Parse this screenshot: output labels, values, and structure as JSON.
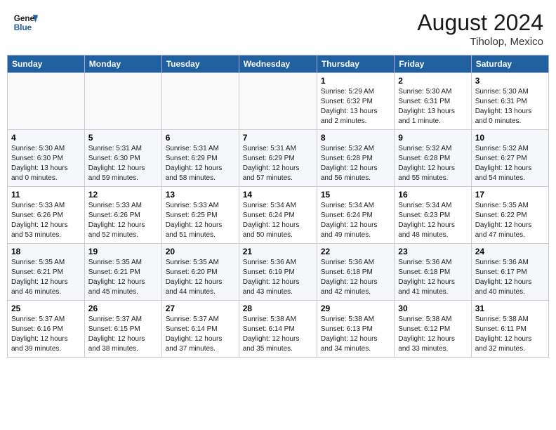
{
  "header": {
    "logo_line1": "General",
    "logo_line2": "Blue",
    "month_year": "August 2024",
    "location": "Tiholop, Mexico"
  },
  "days_of_week": [
    "Sunday",
    "Monday",
    "Tuesday",
    "Wednesday",
    "Thursday",
    "Friday",
    "Saturday"
  ],
  "weeks": [
    [
      {
        "day": "",
        "info": ""
      },
      {
        "day": "",
        "info": ""
      },
      {
        "day": "",
        "info": ""
      },
      {
        "day": "",
        "info": ""
      },
      {
        "day": "1",
        "info": "Sunrise: 5:29 AM\nSunset: 6:32 PM\nDaylight: 13 hours\nand 2 minutes."
      },
      {
        "day": "2",
        "info": "Sunrise: 5:30 AM\nSunset: 6:31 PM\nDaylight: 13 hours\nand 1 minute."
      },
      {
        "day": "3",
        "info": "Sunrise: 5:30 AM\nSunset: 6:31 PM\nDaylight: 13 hours\nand 0 minutes."
      }
    ],
    [
      {
        "day": "4",
        "info": "Sunrise: 5:30 AM\nSunset: 6:30 PM\nDaylight: 13 hours\nand 0 minutes."
      },
      {
        "day": "5",
        "info": "Sunrise: 5:31 AM\nSunset: 6:30 PM\nDaylight: 12 hours\nand 59 minutes."
      },
      {
        "day": "6",
        "info": "Sunrise: 5:31 AM\nSunset: 6:29 PM\nDaylight: 12 hours\nand 58 minutes."
      },
      {
        "day": "7",
        "info": "Sunrise: 5:31 AM\nSunset: 6:29 PM\nDaylight: 12 hours\nand 57 minutes."
      },
      {
        "day": "8",
        "info": "Sunrise: 5:32 AM\nSunset: 6:28 PM\nDaylight: 12 hours\nand 56 minutes."
      },
      {
        "day": "9",
        "info": "Sunrise: 5:32 AM\nSunset: 6:28 PM\nDaylight: 12 hours\nand 55 minutes."
      },
      {
        "day": "10",
        "info": "Sunrise: 5:32 AM\nSunset: 6:27 PM\nDaylight: 12 hours\nand 54 minutes."
      }
    ],
    [
      {
        "day": "11",
        "info": "Sunrise: 5:33 AM\nSunset: 6:26 PM\nDaylight: 12 hours\nand 53 minutes."
      },
      {
        "day": "12",
        "info": "Sunrise: 5:33 AM\nSunset: 6:26 PM\nDaylight: 12 hours\nand 52 minutes."
      },
      {
        "day": "13",
        "info": "Sunrise: 5:33 AM\nSunset: 6:25 PM\nDaylight: 12 hours\nand 51 minutes."
      },
      {
        "day": "14",
        "info": "Sunrise: 5:34 AM\nSunset: 6:24 PM\nDaylight: 12 hours\nand 50 minutes."
      },
      {
        "day": "15",
        "info": "Sunrise: 5:34 AM\nSunset: 6:24 PM\nDaylight: 12 hours\nand 49 minutes."
      },
      {
        "day": "16",
        "info": "Sunrise: 5:34 AM\nSunset: 6:23 PM\nDaylight: 12 hours\nand 48 minutes."
      },
      {
        "day": "17",
        "info": "Sunrise: 5:35 AM\nSunset: 6:22 PM\nDaylight: 12 hours\nand 47 minutes."
      }
    ],
    [
      {
        "day": "18",
        "info": "Sunrise: 5:35 AM\nSunset: 6:21 PM\nDaylight: 12 hours\nand 46 minutes."
      },
      {
        "day": "19",
        "info": "Sunrise: 5:35 AM\nSunset: 6:21 PM\nDaylight: 12 hours\nand 45 minutes."
      },
      {
        "day": "20",
        "info": "Sunrise: 5:35 AM\nSunset: 6:20 PM\nDaylight: 12 hours\nand 44 minutes."
      },
      {
        "day": "21",
        "info": "Sunrise: 5:36 AM\nSunset: 6:19 PM\nDaylight: 12 hours\nand 43 minutes."
      },
      {
        "day": "22",
        "info": "Sunrise: 5:36 AM\nSunset: 6:18 PM\nDaylight: 12 hours\nand 42 minutes."
      },
      {
        "day": "23",
        "info": "Sunrise: 5:36 AM\nSunset: 6:18 PM\nDaylight: 12 hours\nand 41 minutes."
      },
      {
        "day": "24",
        "info": "Sunrise: 5:36 AM\nSunset: 6:17 PM\nDaylight: 12 hours\nand 40 minutes."
      }
    ],
    [
      {
        "day": "25",
        "info": "Sunrise: 5:37 AM\nSunset: 6:16 PM\nDaylight: 12 hours\nand 39 minutes."
      },
      {
        "day": "26",
        "info": "Sunrise: 5:37 AM\nSunset: 6:15 PM\nDaylight: 12 hours\nand 38 minutes."
      },
      {
        "day": "27",
        "info": "Sunrise: 5:37 AM\nSunset: 6:14 PM\nDaylight: 12 hours\nand 37 minutes."
      },
      {
        "day": "28",
        "info": "Sunrise: 5:38 AM\nSunset: 6:14 PM\nDaylight: 12 hours\nand 35 minutes."
      },
      {
        "day": "29",
        "info": "Sunrise: 5:38 AM\nSunset: 6:13 PM\nDaylight: 12 hours\nand 34 minutes."
      },
      {
        "day": "30",
        "info": "Sunrise: 5:38 AM\nSunset: 6:12 PM\nDaylight: 12 hours\nand 33 minutes."
      },
      {
        "day": "31",
        "info": "Sunrise: 5:38 AM\nSunset: 6:11 PM\nDaylight: 12 hours\nand 32 minutes."
      }
    ]
  ]
}
